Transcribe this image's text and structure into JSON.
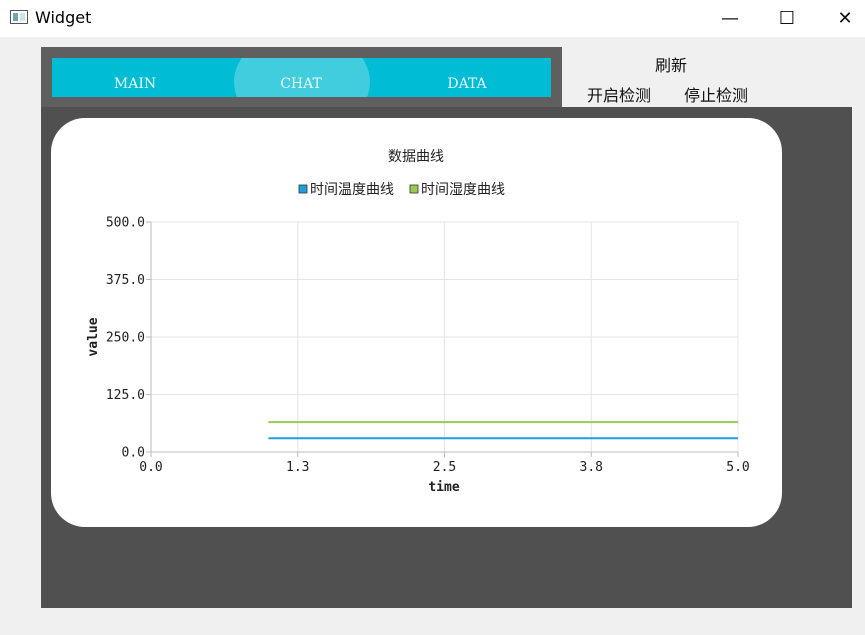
{
  "window": {
    "title": "Widget"
  },
  "tabs": [
    {
      "label": "MAIN"
    },
    {
      "label": "CHAT"
    },
    {
      "label": "DATA"
    }
  ],
  "toolbar": {
    "refresh_label": "刷新",
    "start_label": "开启检测",
    "stop_label": "停止检测"
  },
  "colors": {
    "accent": "#00bcd4",
    "temperature_series": "#209fdf",
    "humidity_series": "#99ca53",
    "chart_background": "#505050"
  },
  "chart_data": {
    "type": "line",
    "title": "数据曲线",
    "xlabel": "time",
    "ylabel": "value",
    "xlim": [
      0,
      5
    ],
    "ylim": [
      0,
      500
    ],
    "x_ticks": [
      "0.0",
      "1.3",
      "2.5",
      "3.8",
      "5.0"
    ],
    "y_ticks": [
      "0.0",
      "125.0",
      "250.0",
      "375.0",
      "500.0"
    ],
    "grid": true,
    "legend": "top",
    "series": [
      {
        "name": "时间温度曲线",
        "color": "#209fdf",
        "points": [
          [
            1.0,
            30
          ],
          [
            5.0,
            30
          ]
        ]
      },
      {
        "name": "时间湿度曲线",
        "color": "#99ca53",
        "points": [
          [
            1.0,
            65
          ],
          [
            5.0,
            65
          ]
        ]
      }
    ]
  }
}
